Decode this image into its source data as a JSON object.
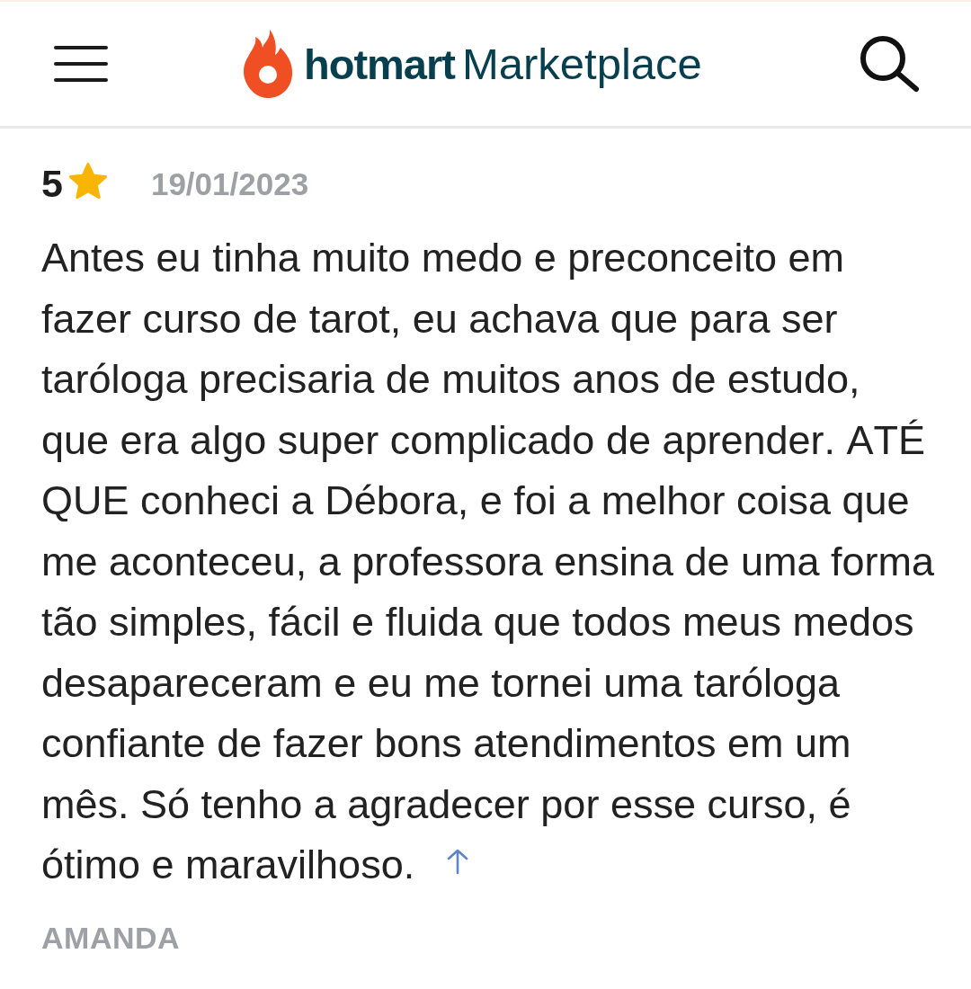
{
  "header": {
    "logo": {
      "brand": "hotmart",
      "product": "Marketplace"
    }
  },
  "review": {
    "rating": "5",
    "date": "19/01/2023",
    "text": "Antes eu tinha muito medo e preconceito em fazer curso de tarot, eu achava que para ser taróloga precisaria de muitos anos de estudo, que era algo super complicado de aprender. ATÉ QUE conheci a Débora, e foi a melhor coisa que me aconteceu, a professora ensina de uma forma tão simples, fácil e fluida que todos meus medos desapareceram e eu me tornei uma taróloga confiante de fazer bons atendimentos em um mês. Só tenho a agradecer por esse curso, é ótimo e maravilhoso.",
    "author": "AMANDA"
  }
}
